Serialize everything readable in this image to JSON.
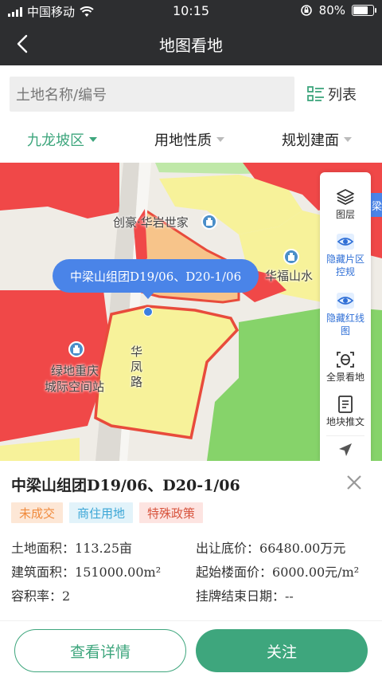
{
  "status_bar": {
    "carrier": "中国移动",
    "time": "10:15",
    "battery": "80%",
    "battery_level": 0.8
  },
  "nav": {
    "title": "地图看地"
  },
  "search": {
    "placeholder": "土地名称/编号",
    "list_label": "列表"
  },
  "filters": [
    {
      "label": "九龙坡区",
      "active": true
    },
    {
      "label": "用地性质",
      "active": false
    },
    {
      "label": "规划建面",
      "active": false
    }
  ],
  "map": {
    "labels": {
      "chuanghao": "创豪·华岩世家",
      "huafu": "华福山水",
      "lvdi_line1": "绿地重庆",
      "lvdi_line2": "城际空间站",
      "road": [
        "华",
        "凤",
        "路"
      ]
    },
    "callout": "中梁山组团D19/06、D20-1/06",
    "peek_tag": "中梁",
    "tools": [
      {
        "label": "图层",
        "icon": "layers-icon"
      },
      {
        "label": "隐藏片区控规",
        "icon": "eye-icon"
      },
      {
        "label": "隐藏红线图",
        "icon": "eye-icon"
      },
      {
        "label": "全景看地",
        "icon": "panorama-icon"
      },
      {
        "label": "地块推文",
        "icon": "document-icon"
      },
      {
        "label": "",
        "icon": "locate-icon"
      }
    ]
  },
  "parcel": {
    "name": "中梁山组团D19/06、D20-1/06",
    "tags": [
      "未成交",
      "商住用地",
      "特殊政策"
    ],
    "details": {
      "land_area_label": "土地面积：",
      "land_area": "113.25亩",
      "floor_price_label": "出让底价：",
      "floor_price": "66480.00万元",
      "build_area_label": "建筑面积：",
      "build_area": "151000.00m²",
      "unit_price_label": "起始楼面价：",
      "unit_price": "6000.00元/m²",
      "far_label": "容积率：",
      "far": "2",
      "end_date_label": "挂牌结束日期：",
      "end_date": "--"
    }
  },
  "actions": {
    "detail": "查看详情",
    "follow": "关注"
  },
  "colors": {
    "accent": "#3ea67d",
    "nav": "#2d2e30",
    "callout": "#4a84e8",
    "commercial": "#f04848",
    "residential": "#f7f29a",
    "green": "#86d36a"
  }
}
